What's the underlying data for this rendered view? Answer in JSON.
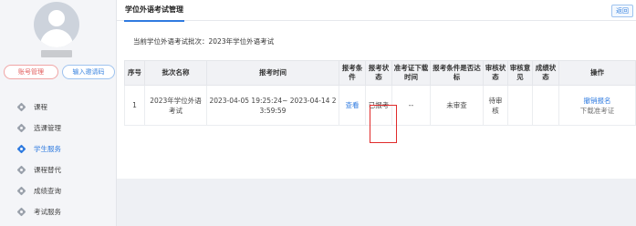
{
  "sidebar": {
    "btn_change_password": "账号管理",
    "btn_invite_code": "输入邀请码",
    "items": [
      {
        "label": "课程"
      },
      {
        "label": "选课管理"
      },
      {
        "label": "学生服务"
      },
      {
        "label": "课程替代"
      },
      {
        "label": "成绩查询"
      },
      {
        "label": "考试服务"
      }
    ],
    "active_index": 2
  },
  "header": {
    "title": "学位外语考试管理",
    "back": "返回"
  },
  "batch_line": "当前学位外语考试批次：2023年学位外语考试",
  "table": {
    "columns": [
      "序号",
      "批次名称",
      "报考时间",
      "报考条件",
      "报考状态",
      "准考证下载时间",
      "报考条件是否达标",
      "审核状态",
      "审核意见",
      "成绩状态",
      "操作"
    ],
    "rows": [
      {
        "index": "1",
        "batch_name": "2023年学位外语考试",
        "time": "2023-04-05 19:25:24~ 2023-04-14 23:59:59",
        "condition": "查看",
        "status": "已报考",
        "ticket_time": "--",
        "qualified": "未审查",
        "review_status": "待审核",
        "review_opinion": "",
        "score_status": "",
        "op_cancel": "撤销报名",
        "op_download": "下载准考证"
      }
    ]
  },
  "colors": {
    "accent": "#2f7be0",
    "highlight": "#e02b2b"
  }
}
